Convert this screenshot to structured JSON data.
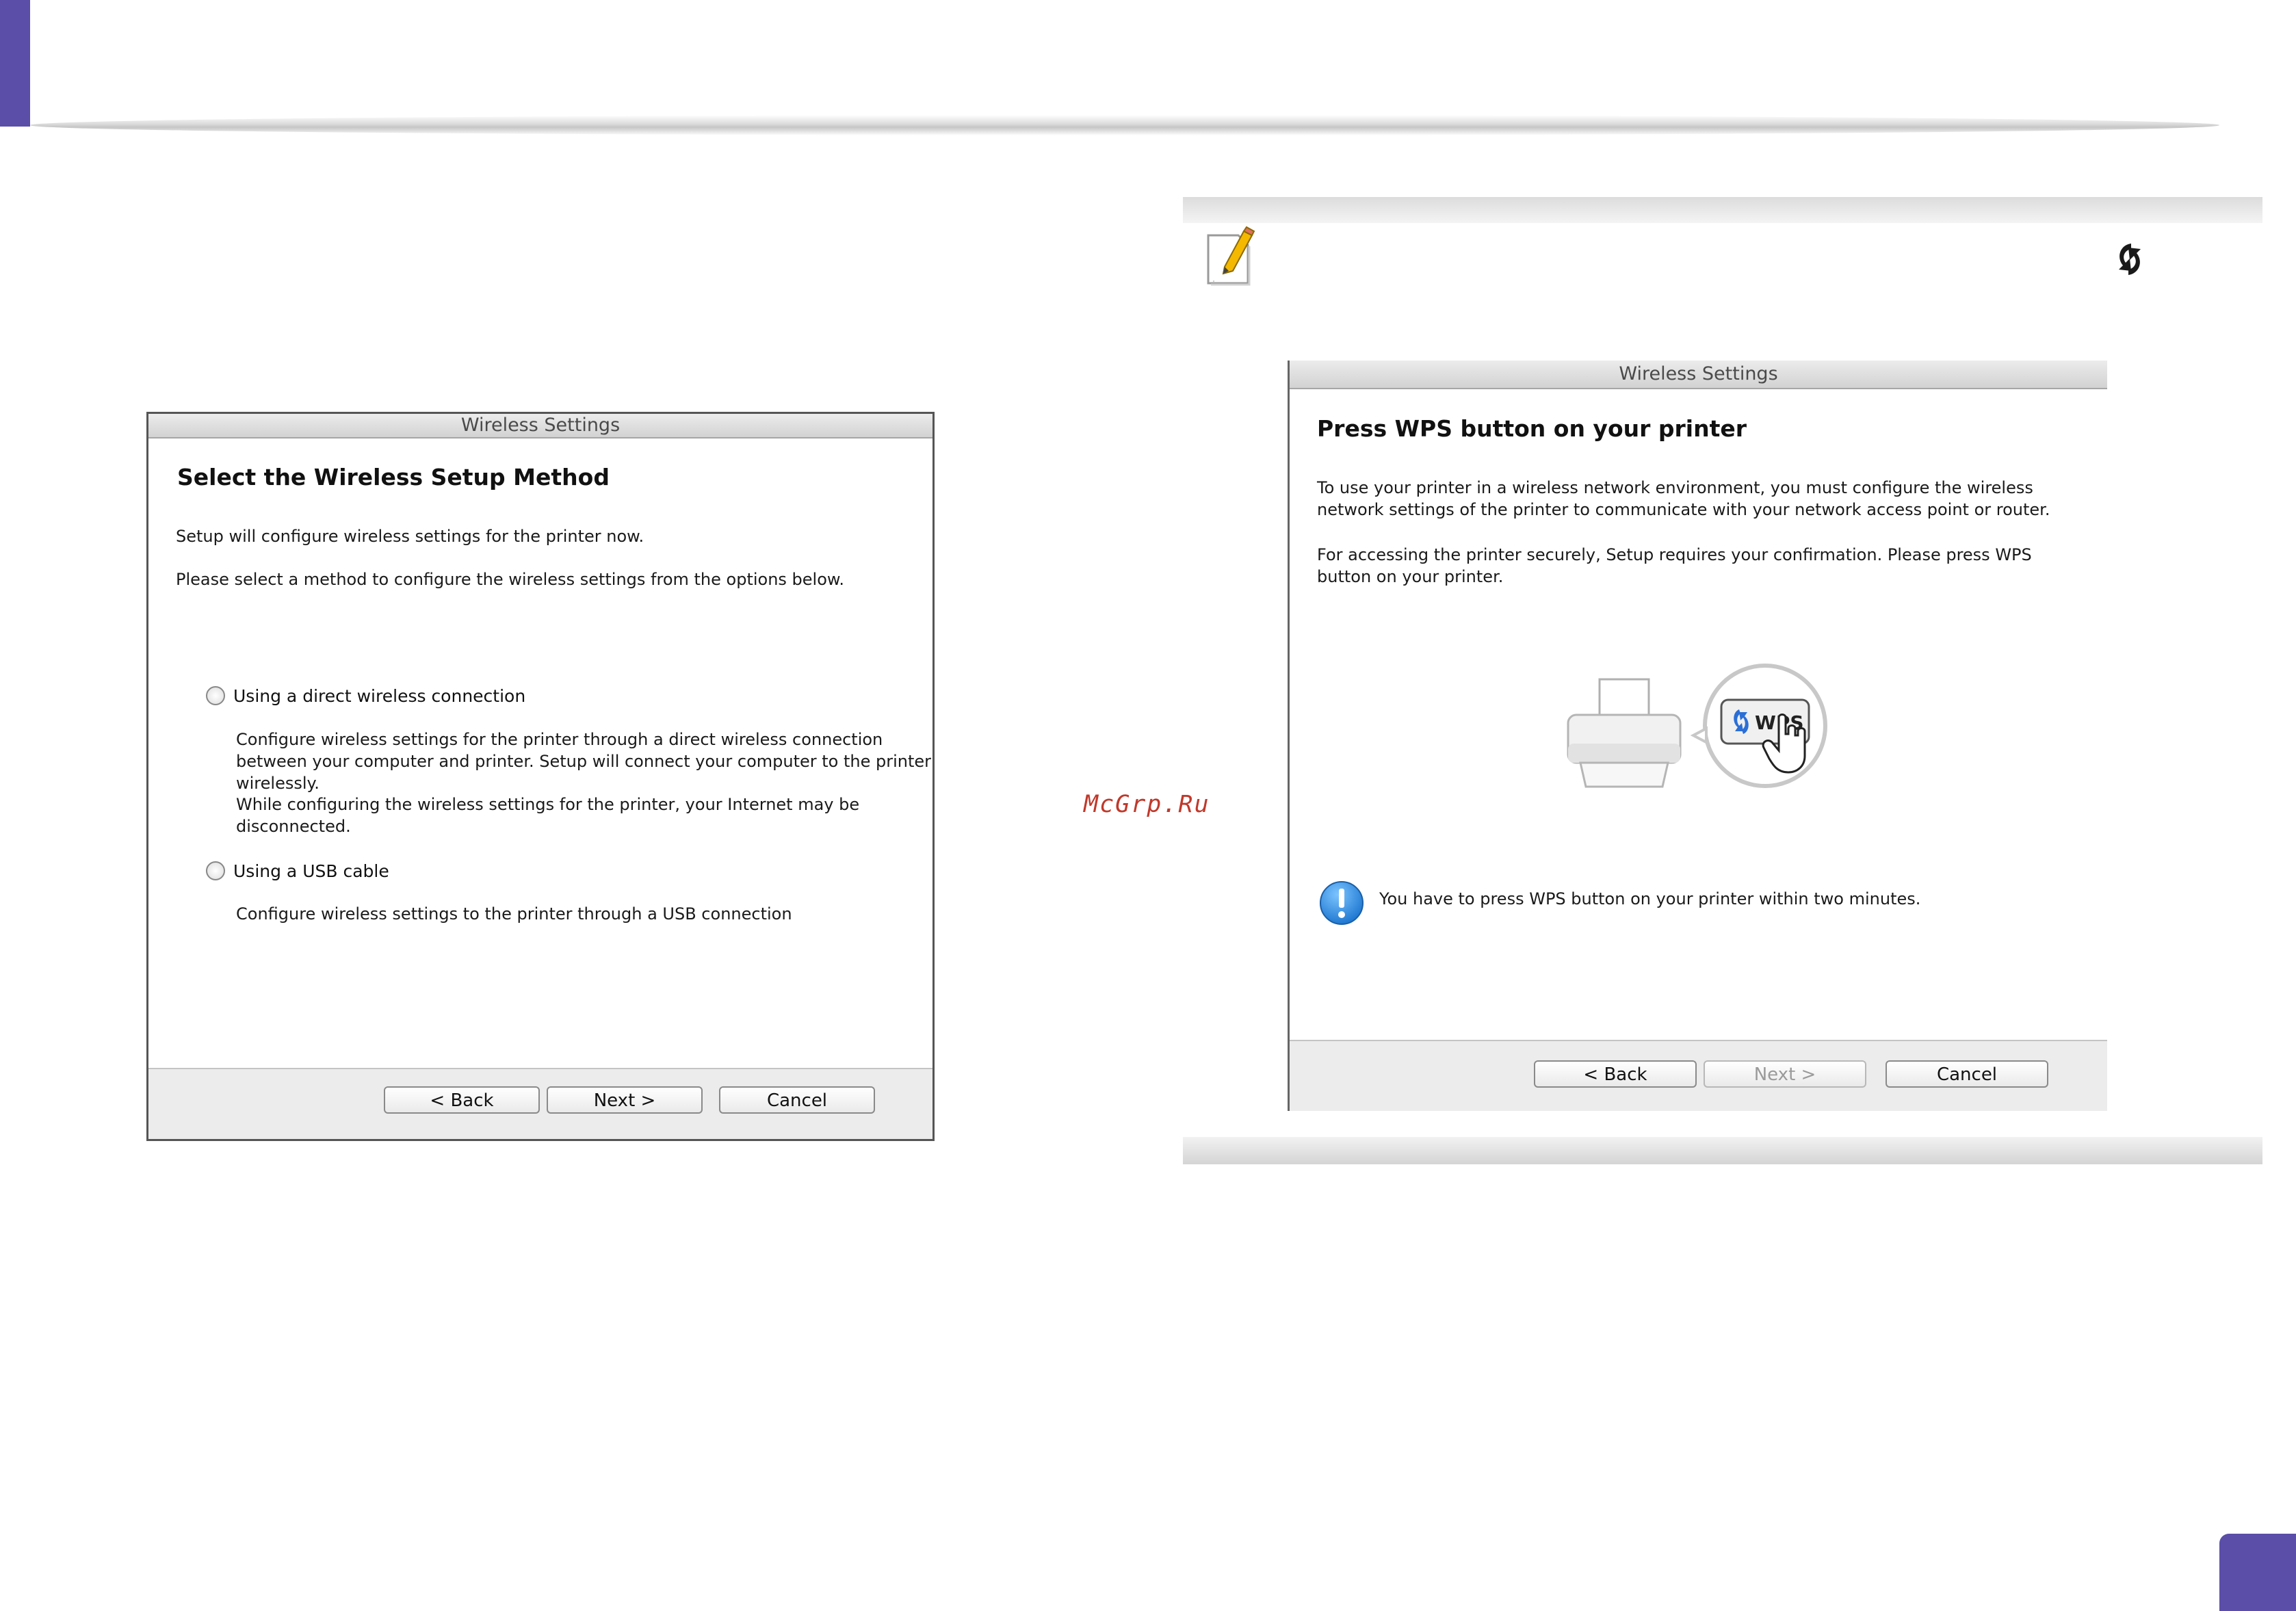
{
  "watermark": "McGrp.Ru",
  "left_dialog": {
    "window_title": "Wireless Settings",
    "heading": "Select the Wireless Setup Method",
    "intro_line1": "Setup will configure wireless settings for the printer now.",
    "intro_line2": "Please select a method to configure the wireless settings from the options below.",
    "options": [
      {
        "label": "Using a direct wireless connection",
        "description_lines": [
          "Configure wireless settings for the printer through a direct wireless connection",
          "between your computer and printer. Setup will connect your computer to the printer",
          "wirelessly.",
          "While configuring the wireless settings for the printer, your Internet may be",
          "disconnected."
        ]
      },
      {
        "label": "Using a USB cable",
        "description_lines": [
          "Configure wireless settings to the printer through a USB connection"
        ]
      }
    ],
    "buttons": {
      "back": "< Back",
      "next": "Next >",
      "cancel": "Cancel"
    }
  },
  "note_panel": {
    "note_icon": "note-pencil-icon",
    "inline_icon": "wps-icon"
  },
  "right_dialog": {
    "window_title": "Wireless Settings",
    "heading": "Press WPS button on your printer",
    "para1_lines": [
      "To use your printer in a wireless network environment, you must configure the wireless",
      "network settings of the printer to communicate with your network access point or router."
    ],
    "para2_lines": [
      "For accessing the printer securely, Setup requires your confirmation. Please press WPS",
      "button on your printer."
    ],
    "wps_button_label": "WPS",
    "info_message": "You have to press WPS button on your printer within two minutes.",
    "buttons": {
      "back": "< Back",
      "next": "Next >",
      "next_enabled": false,
      "cancel": "Cancel"
    }
  },
  "colors": {
    "accent": "#5a4ea8",
    "info_blue": "#2b8fe0"
  }
}
